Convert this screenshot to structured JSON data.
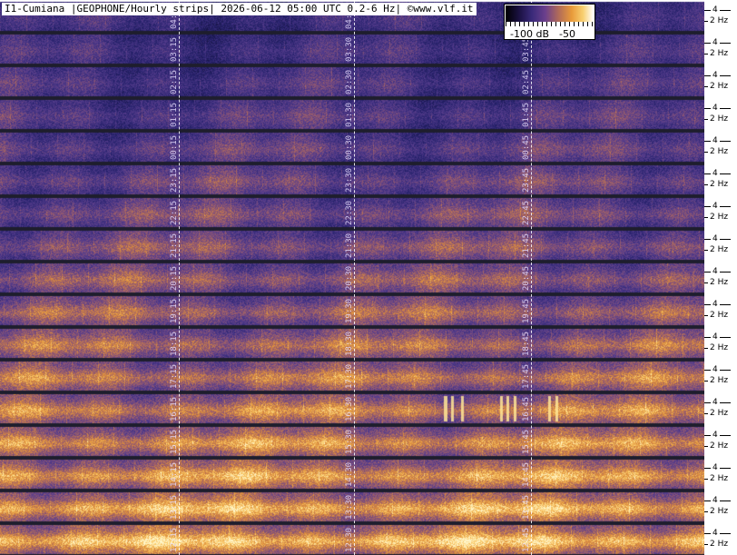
{
  "title": "I1-Cumiana |GEOPHONE/Hourly strips| 2026-06-12 05:00 UTC 0.2-6 Hz| ©www.vlf.it",
  "colorbar": {
    "min_label": "-100 dB",
    "max_label": "-50"
  },
  "axis": {
    "tick_top": "4",
    "tick_bottom": "2 Hz"
  },
  "strips": [
    {
      "labels": [
        "04:15",
        "04:30",
        "04:45"
      ]
    },
    {
      "labels": [
        "03:15",
        "03:30",
        "03:45"
      ]
    },
    {
      "labels": [
        "02:15",
        "02:30",
        "02:45"
      ]
    },
    {
      "labels": [
        "01:15",
        "01:30",
        "01:45"
      ]
    },
    {
      "labels": [
        "00:15",
        "00:30",
        "00:45"
      ]
    },
    {
      "labels": [
        "23:15",
        "23:30",
        "23:45"
      ]
    },
    {
      "labels": [
        "22:15",
        "22:30",
        "22:45"
      ]
    },
    {
      "labels": [
        "21:15",
        "21:30",
        "21:45"
      ]
    },
    {
      "labels": [
        "20:15",
        "20:30",
        "20:45"
      ]
    },
    {
      "labels": [
        "19:15",
        "19:30",
        "19:45"
      ]
    },
    {
      "labels": [
        "18:15",
        "18:30",
        "18:45"
      ]
    },
    {
      "labels": [
        "17:15",
        "17:30",
        "17:45"
      ]
    },
    {
      "labels": [
        "16:15",
        "16:30",
        "16:45"
      ]
    },
    {
      "labels": [
        "15:15",
        "15:30",
        "15:45"
      ]
    },
    {
      "labels": [
        "14:15",
        "14:30",
        "14:45"
      ]
    },
    {
      "labels": [
        "13:15",
        "13:30",
        "13:45"
      ]
    },
    {
      "labels": [
        "12:15",
        "12:30",
        "12:45"
      ]
    }
  ],
  "colors": {
    "low": "#2a2060",
    "mid": "#6a3f8c",
    "high": "#e89a3a",
    "peak": "#ffe090",
    "grid": "#ffffff"
  }
}
